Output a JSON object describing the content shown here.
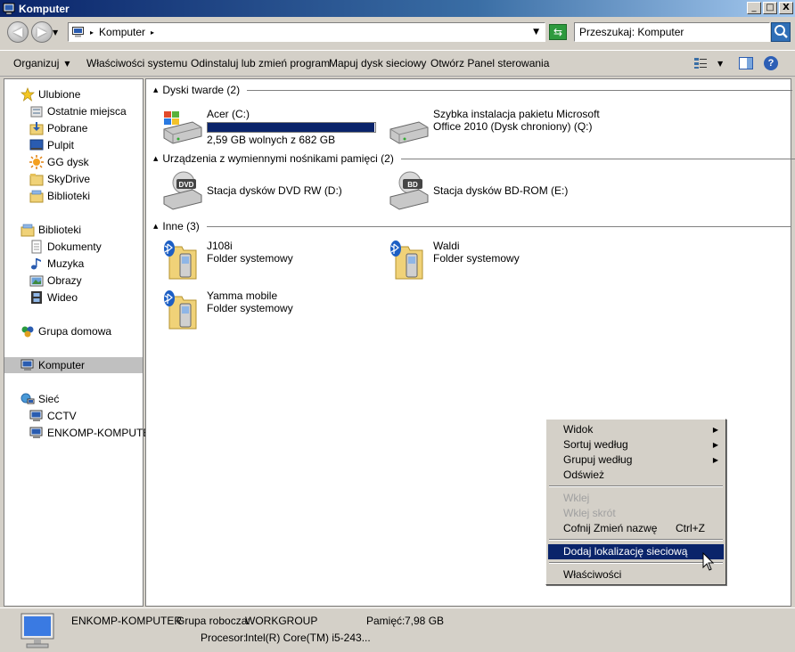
{
  "window": {
    "title": "Komputer",
    "controls": [
      "_",
      "□",
      "X"
    ]
  },
  "address_bar": {
    "path_segment": "Komputer",
    "search_placeholder": "Przeszukaj: Komputer"
  },
  "toolbar": {
    "organize": "Organizuj",
    "system_properties": "Właściwości systemu",
    "uninstall": "Odinstaluj lub zmień program",
    "map_drive": "Mapuj dysk sieciowy",
    "control_panel": "Otwórz Panel sterowania",
    "help": "?"
  },
  "nav": {
    "favorites": "Ulubione",
    "recent": "Ostatnie miejsca",
    "downloads": "Pobrane",
    "desktop": "Pulpit",
    "gg": "GG dysk",
    "skydrive": "SkyDrive",
    "libraries_fav": "Biblioteki",
    "libraries": "Biblioteki",
    "documents": "Dokumenty",
    "music": "Muzyka",
    "pictures": "Obrazy",
    "video": "Wideo",
    "homegroup": "Grupa domowa",
    "computer": "Komputer",
    "network": "Sieć",
    "cctv": "CCTV",
    "enkomp": "ENKOMP-KOMPUTER"
  },
  "groups": {
    "hard_drives": "Dyski twarde (2)",
    "removable": "Urządzenia z wymiennymi nośnikami pamięci (2)",
    "other": "Inne (3)"
  },
  "items": {
    "acer": {
      "name": "Acer (C:)",
      "info": "2,59 GB wolnych z 682 GB",
      "used_fraction": 0.996
    },
    "office_line1": "Szybka instalacja pakietu Microsoft",
    "office_line2": "Office 2010 (Dysk chroniony) (Q:)",
    "dvd": "Stacja dysków DVD RW (D:)",
    "bd": "Stacja dysków BD-ROM (E:)",
    "j108i": {
      "name": "J108i",
      "type": "Folder systemowy"
    },
    "waldi": {
      "name": "Waldi",
      "type": "Folder systemowy"
    },
    "yamma": {
      "name": "Yamma mobile",
      "type": "Folder systemowy"
    },
    "dvd_badge": "DVD",
    "bd_badge": "BD"
  },
  "details": {
    "computer_name": "ENKOMP-KOMPUTER",
    "workgroup_label": "Grupa robocza:",
    "workgroup_value": "WORKGROUP",
    "memory_label": "Pamięć:",
    "memory_value": "7,98 GB",
    "cpu_label": "Procesor:",
    "cpu_value": "Intel(R) Core(TM) i5-243..."
  },
  "context_menu": {
    "view": "Widok",
    "sort": "Sortuj według",
    "group": "Grupuj według",
    "refresh": "Odśwież",
    "paste": "Wklej",
    "paste_shortcut": "Wklej skrót",
    "undo": "Cofnij Zmień nazwę",
    "undo_shortcut": "Ctrl+Z",
    "add_network": "Dodaj lokalizację sieciową",
    "properties": "Właściwości"
  },
  "icons": {
    "favorites": "star-icon",
    "drive": "hard-drive-icon",
    "bluetooth_folder": "bluetooth-phone-folder-icon"
  }
}
